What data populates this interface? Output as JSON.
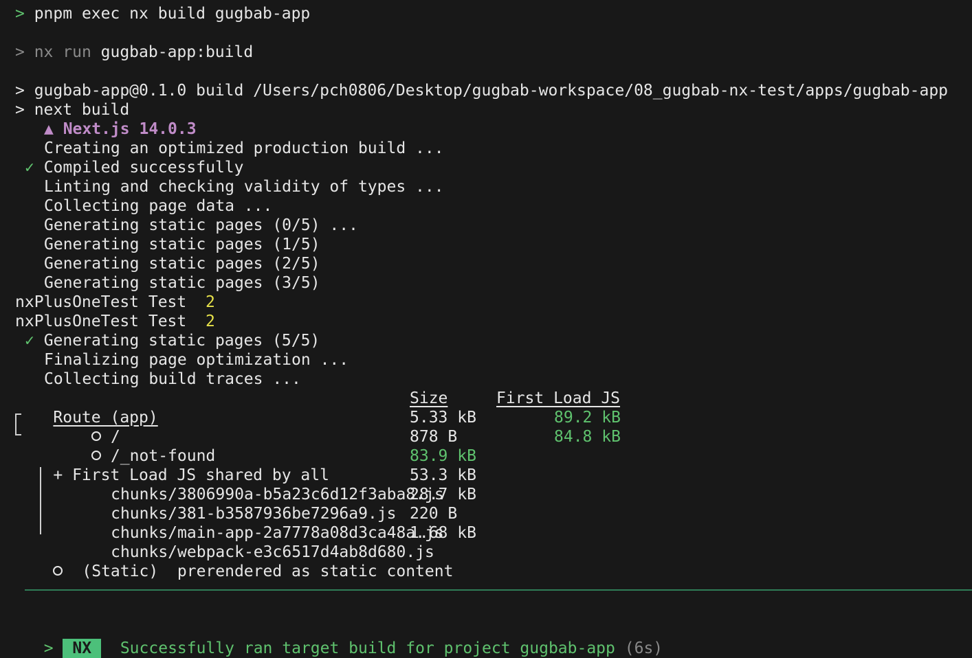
{
  "lines": {
    "l1_prompt": ">",
    "l1_cmd": " pnpm exec nx build gugbab-app",
    "l2_prompt": ">",
    "l2_dim": " nx run",
    "l2_rest": " gugbab-app:build",
    "l3": "> gugbab-app@0.1.0 build /Users/pch0806/Desktop/gugbab-workspace/08_gugbab-nx-test/apps/gugbab-app",
    "l4": "> next build",
    "l5": "▲ Next.js 14.0.3",
    "l6": "Creating an optimized production build ...",
    "l7_check": "✓",
    "l7": " Compiled successfully",
    "l8": "Linting and checking validity of types ...",
    "l9": "Collecting page data ...",
    "l10": "Generating static pages (0/5) ...",
    "l11": "Generating static pages (1/5)",
    "l12": "Generating static pages (2/5)",
    "l13": "Generating static pages (3/5)",
    "l14_text": "nxPlusOneTest Test  ",
    "l14_num": "2",
    "l15_text": "nxPlusOneTest Test  ",
    "l15_num": "2",
    "l16_check": "✓",
    "l16": " Generating static pages (5/5)",
    "l17": "Finalizing page optimization ...",
    "l18": "Collecting build traces ..."
  },
  "route_table": {
    "headers": {
      "route": "Route (app)",
      "size": "Size",
      "first_load": "First Load JS"
    },
    "rows": [
      {
        "path": "/",
        "size": "5.33 kB",
        "first_load": "89.2 kB"
      },
      {
        "path": "/_not-found",
        "size": "878 B",
        "first_load": "84.8 kB"
      }
    ],
    "shared_label": "+ First Load JS shared by all",
    "shared_size": "83.9 kB",
    "chunks": [
      {
        "name": "chunks/3806990a-b5a23c6d12f3aba8.js",
        "size": "53.3 kB"
      },
      {
        "name": "chunks/381-b3587936be7296a9.js",
        "size": "28.7 kB"
      },
      {
        "name": "chunks/main-app-2a7778a08d3ca48a.js",
        "size": "220 B"
      },
      {
        "name": "chunks/webpack-e3c6517d4ab8d680.js",
        "size": "1.68 kB"
      }
    ],
    "legend_label": "(Static)",
    "legend_desc": "prerendered as static content"
  },
  "summary": {
    "prompt": ">",
    "badge": "NX",
    "message": "Successfully ran target build for project gugbab-app",
    "duration": "(6s)"
  },
  "colors": {
    "background": "#181818",
    "green": "#5fc26e",
    "purple": "#c08cc8",
    "yellow": "#e6e14a",
    "badge": "#4cc07a"
  }
}
